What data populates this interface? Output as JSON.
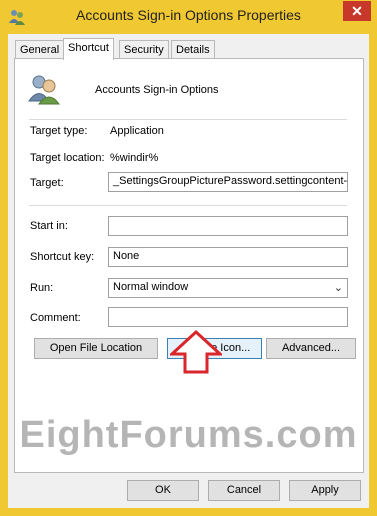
{
  "window": {
    "title": "Accounts Sign-in Options Properties",
    "close_glyph": "✕"
  },
  "tabs": [
    {
      "label": "General"
    },
    {
      "label": "Shortcut",
      "active": true
    },
    {
      "label": "Security"
    },
    {
      "label": "Details"
    }
  ],
  "shortcut": {
    "name": "Accounts Sign-in Options",
    "target_type_label": "Target type:",
    "target_type_value": "Application",
    "target_location_label": "Target location:",
    "target_location_value": "%windir%",
    "target_label": "Target:",
    "target_value": "_SettingsGroupPicturePassword.settingcontent-ms",
    "start_in_label": "Start in:",
    "start_in_value": "",
    "shortcut_key_label": "Shortcut key:",
    "shortcut_key_value": "None",
    "run_label": "Run:",
    "run_value": "Normal window",
    "comment_label": "Comment:",
    "comment_value": ""
  },
  "buttons": {
    "open_file_location": "Open File Location",
    "change_icon": "Change Icon...",
    "advanced": "Advanced...",
    "ok": "OK",
    "cancel": "Cancel",
    "apply": "Apply"
  },
  "watermark": "EightForums.com",
  "colors": {
    "frame": "#f0c832",
    "close": "#c7382b",
    "arrow": "#d9262a",
    "focus": "#3c7fb1"
  },
  "icons": {
    "app": "users-icon",
    "arrow": "arrow-up-icon"
  }
}
